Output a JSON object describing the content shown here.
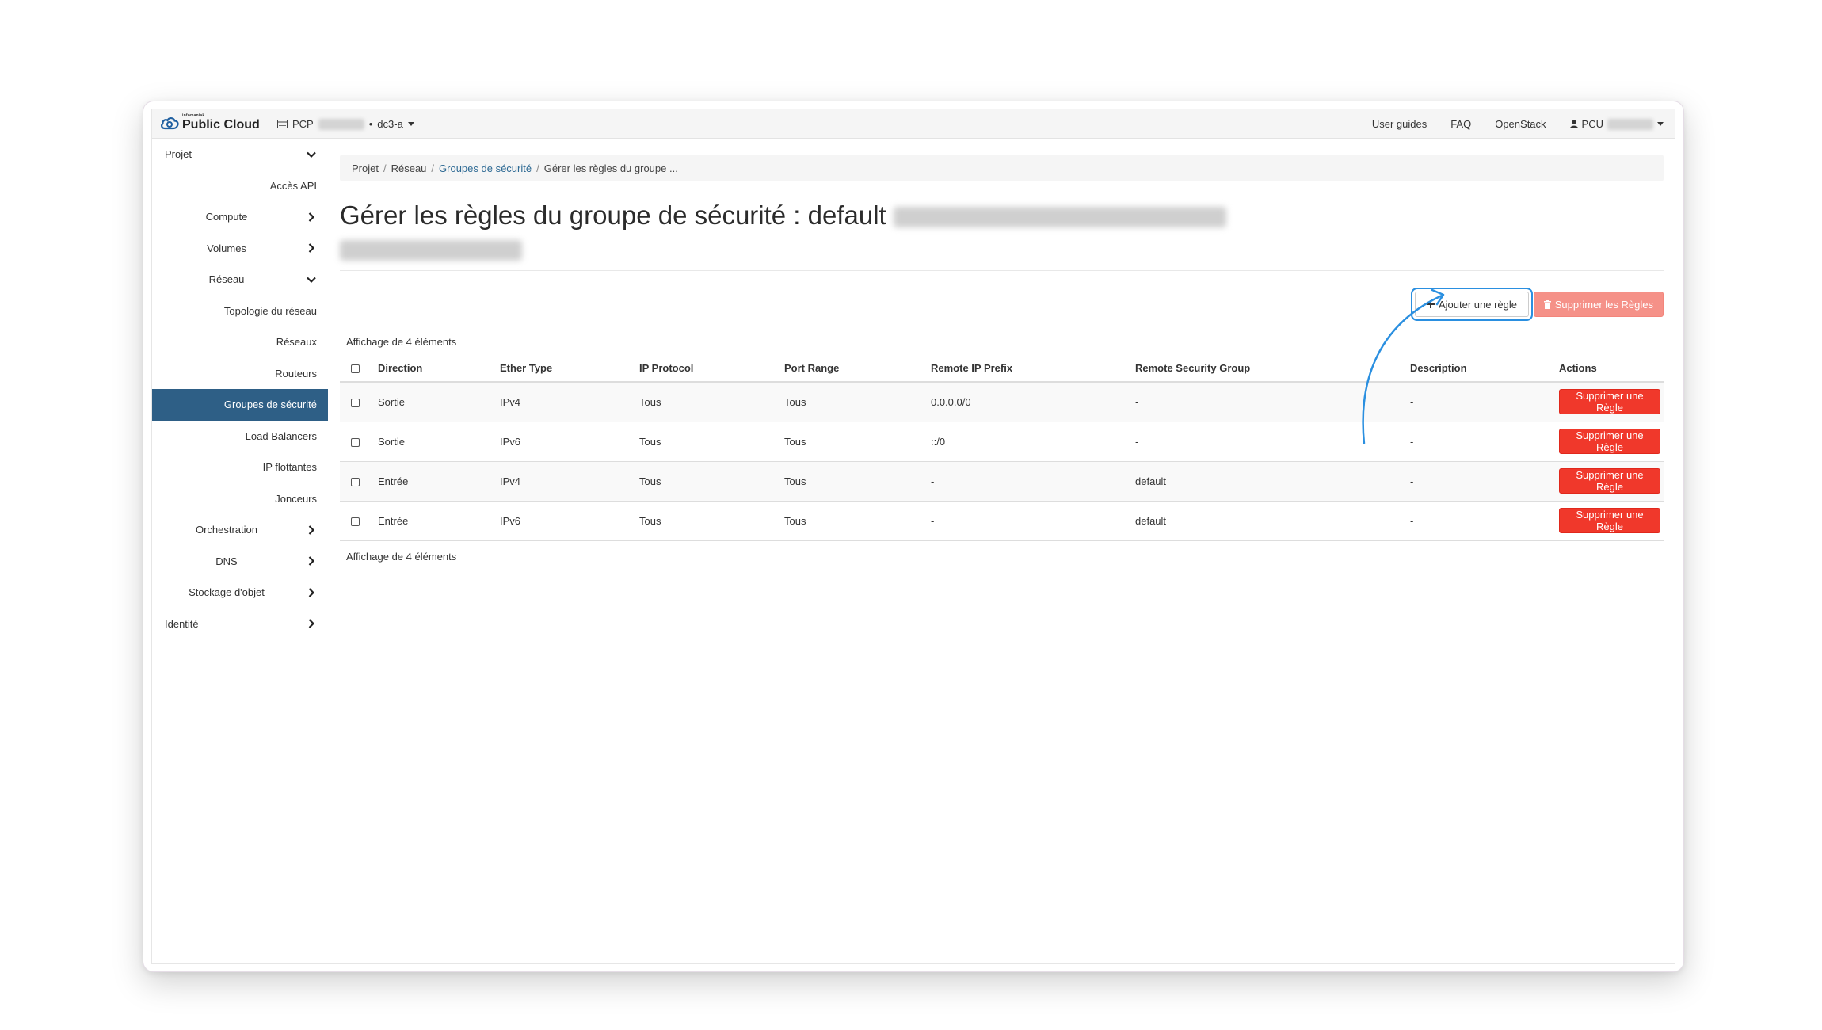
{
  "topbar": {
    "brand_small": "infomaniak",
    "brand": "Public Cloud",
    "project_prefix": "PCP",
    "region": "dc3-a",
    "links": [
      "User guides",
      "FAQ",
      "OpenStack"
    ],
    "user_prefix": "PCU"
  },
  "sidebar": {
    "items": [
      {
        "label": "Projet",
        "level": "top",
        "chevron": "down"
      },
      {
        "label": "Accès API",
        "level": "sub"
      },
      {
        "label": "Compute",
        "level": "mid",
        "chevron": "right"
      },
      {
        "label": "Volumes",
        "level": "mid",
        "chevron": "right"
      },
      {
        "label": "Réseau",
        "level": "mid",
        "chevron": "down"
      },
      {
        "label": "Topologie du réseau",
        "level": "sub"
      },
      {
        "label": "Réseaux",
        "level": "sub"
      },
      {
        "label": "Routeurs",
        "level": "sub"
      },
      {
        "label": "Groupes de sécurité",
        "level": "sub",
        "active": true
      },
      {
        "label": "Load Balancers",
        "level": "sub"
      },
      {
        "label": "IP flottantes",
        "level": "sub"
      },
      {
        "label": "Jonceurs",
        "level": "sub"
      },
      {
        "label": "Orchestration",
        "level": "mid",
        "chevron": "right"
      },
      {
        "label": "DNS",
        "level": "mid",
        "chevron": "right"
      },
      {
        "label": "Stockage d'objet",
        "level": "mid",
        "chevron": "right"
      },
      {
        "label": "Identité",
        "level": "top",
        "chevron": "right"
      }
    ]
  },
  "breadcrumb": {
    "items": [
      "Projet",
      "Réseau",
      "Groupes de sécurité",
      "Gérer les règles du groupe ..."
    ]
  },
  "page": {
    "title": "Gérer les règles du groupe de sécurité : default",
    "add_rule": "Ajouter une règle",
    "delete_rules": "Supprimer les Règles",
    "count": "Affichage de 4 éléments"
  },
  "table": {
    "headers": [
      "Direction",
      "Ether Type",
      "IP Protocol",
      "Port Range",
      "Remote IP Prefix",
      "Remote Security Group",
      "Description",
      "Actions"
    ],
    "rows": [
      [
        "Sortie",
        "IPv4",
        "Tous",
        "Tous",
        "0.0.0.0/0",
        "-",
        "-"
      ],
      [
        "Sortie",
        "IPv6",
        "Tous",
        "Tous",
        "::/0",
        "-",
        "-"
      ],
      [
        "Entrée",
        "IPv4",
        "Tous",
        "Tous",
        "-",
        "default",
        "-"
      ],
      [
        "Entrée",
        "IPv6",
        "Tous",
        "Tous",
        "-",
        "default",
        "-"
      ]
    ],
    "row_action": "Supprimer une Règle"
  },
  "colors": {
    "active_nav": "#2e5f86",
    "danger": "#f0382b",
    "danger_light": "#f59188",
    "annotation": "#2a8fe0"
  }
}
